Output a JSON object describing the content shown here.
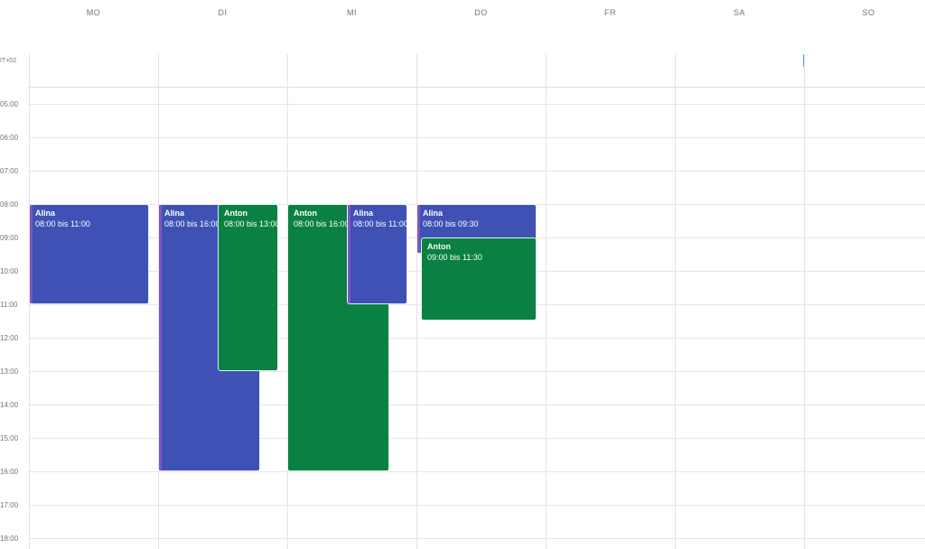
{
  "calendar": {
    "timezone_label": "IT+02",
    "days": [
      "MO",
      "DI",
      "MI",
      "DO",
      "FR",
      "SA",
      "SO"
    ],
    "hours": [
      "05:00",
      "06:00",
      "07:00",
      "08:00",
      "09:00",
      "10:00",
      "11:00",
      "12:00",
      "13:00",
      "14:00",
      "15:00",
      "16:00",
      "17:00",
      "18:00"
    ],
    "colors": {
      "blue": "#3f51b5",
      "green": "#0b8043",
      "stripe": "#7e57c2"
    },
    "events": [
      {
        "id": "mo-alina",
        "title": "Alina",
        "time": "08:00 bis 11:00",
        "color": "#3f51b5"
      },
      {
        "id": "di-alina",
        "title": "Alina",
        "time": "08:00 bis 16:00",
        "color": "#3f51b5"
      },
      {
        "id": "di-anton",
        "title": "Anton",
        "time": "08:00 bis 13:00",
        "color": "#0b8043"
      },
      {
        "id": "mi-anton",
        "title": "Anton",
        "time": "08:00 bis 16:00",
        "color": "#0b8043"
      },
      {
        "id": "mi-alina",
        "title": "Alina",
        "time": "08:00 bis 11:00",
        "color": "#3f51b5"
      },
      {
        "id": "do-alina",
        "title": "Alina",
        "time": "08:00 bis 09:30",
        "color": "#3f51b5"
      },
      {
        "id": "do-anton",
        "title": "Anton",
        "time": "09:00 bis 11:30",
        "color": "#0b8043"
      }
    ]
  }
}
